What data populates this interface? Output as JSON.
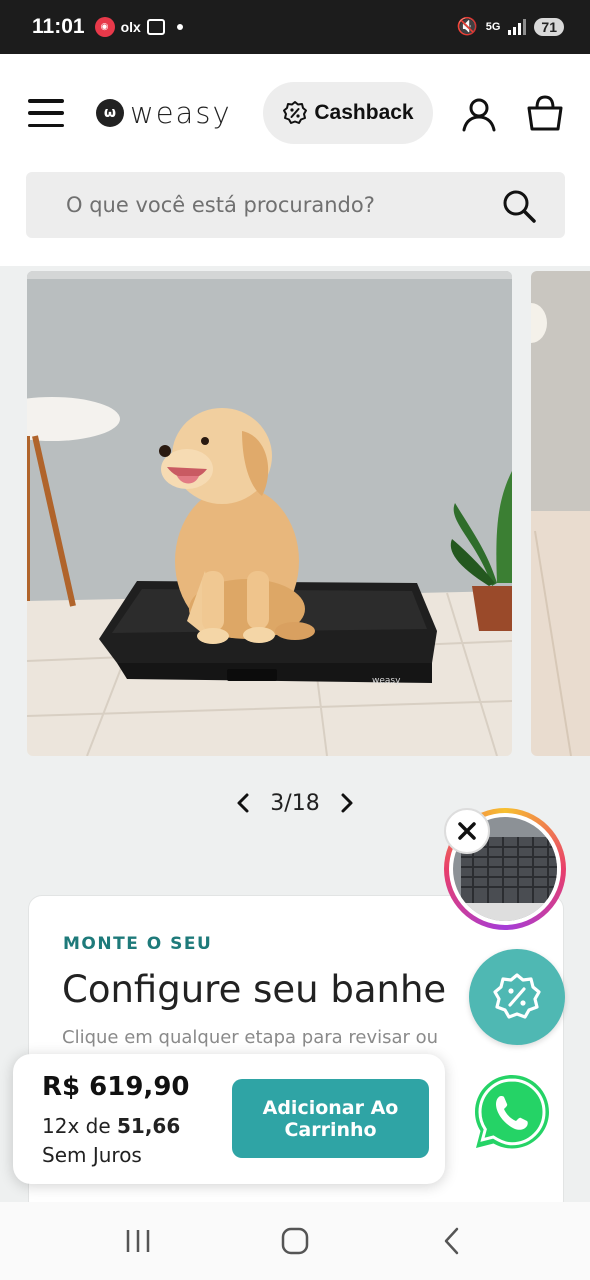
{
  "status_bar": {
    "time": "11:01",
    "app_badge": "olx",
    "network": "5G",
    "battery": "71"
  },
  "header": {
    "logo_text": "weasy",
    "cashback_label": "Cashback",
    "icons": [
      "menu-icon",
      "user-icon",
      "bag-icon"
    ]
  },
  "search": {
    "placeholder": "O que você está procurando?"
  },
  "carousel": {
    "pager": "3/18",
    "product_brand_mark": "weasy"
  },
  "configurator": {
    "eyebrow": "MONTE O SEU",
    "title": "Configure seu banhe",
    "subtitle": "Clique em qualquer etapa para revisar ou"
  },
  "purchase": {
    "price": "R$ 619,90",
    "installments_prefix": "12x de ",
    "installments_value": "51,66",
    "interest_note": "Sem Juros",
    "add_button": "Adicionar Ao Carrinho"
  },
  "colors": {
    "accent_teal": "#2fa4a5",
    "eyebrow_teal": "#1e7a7a",
    "floating_teal": "#4fb8b3",
    "whatsapp_green": "#25d366"
  }
}
